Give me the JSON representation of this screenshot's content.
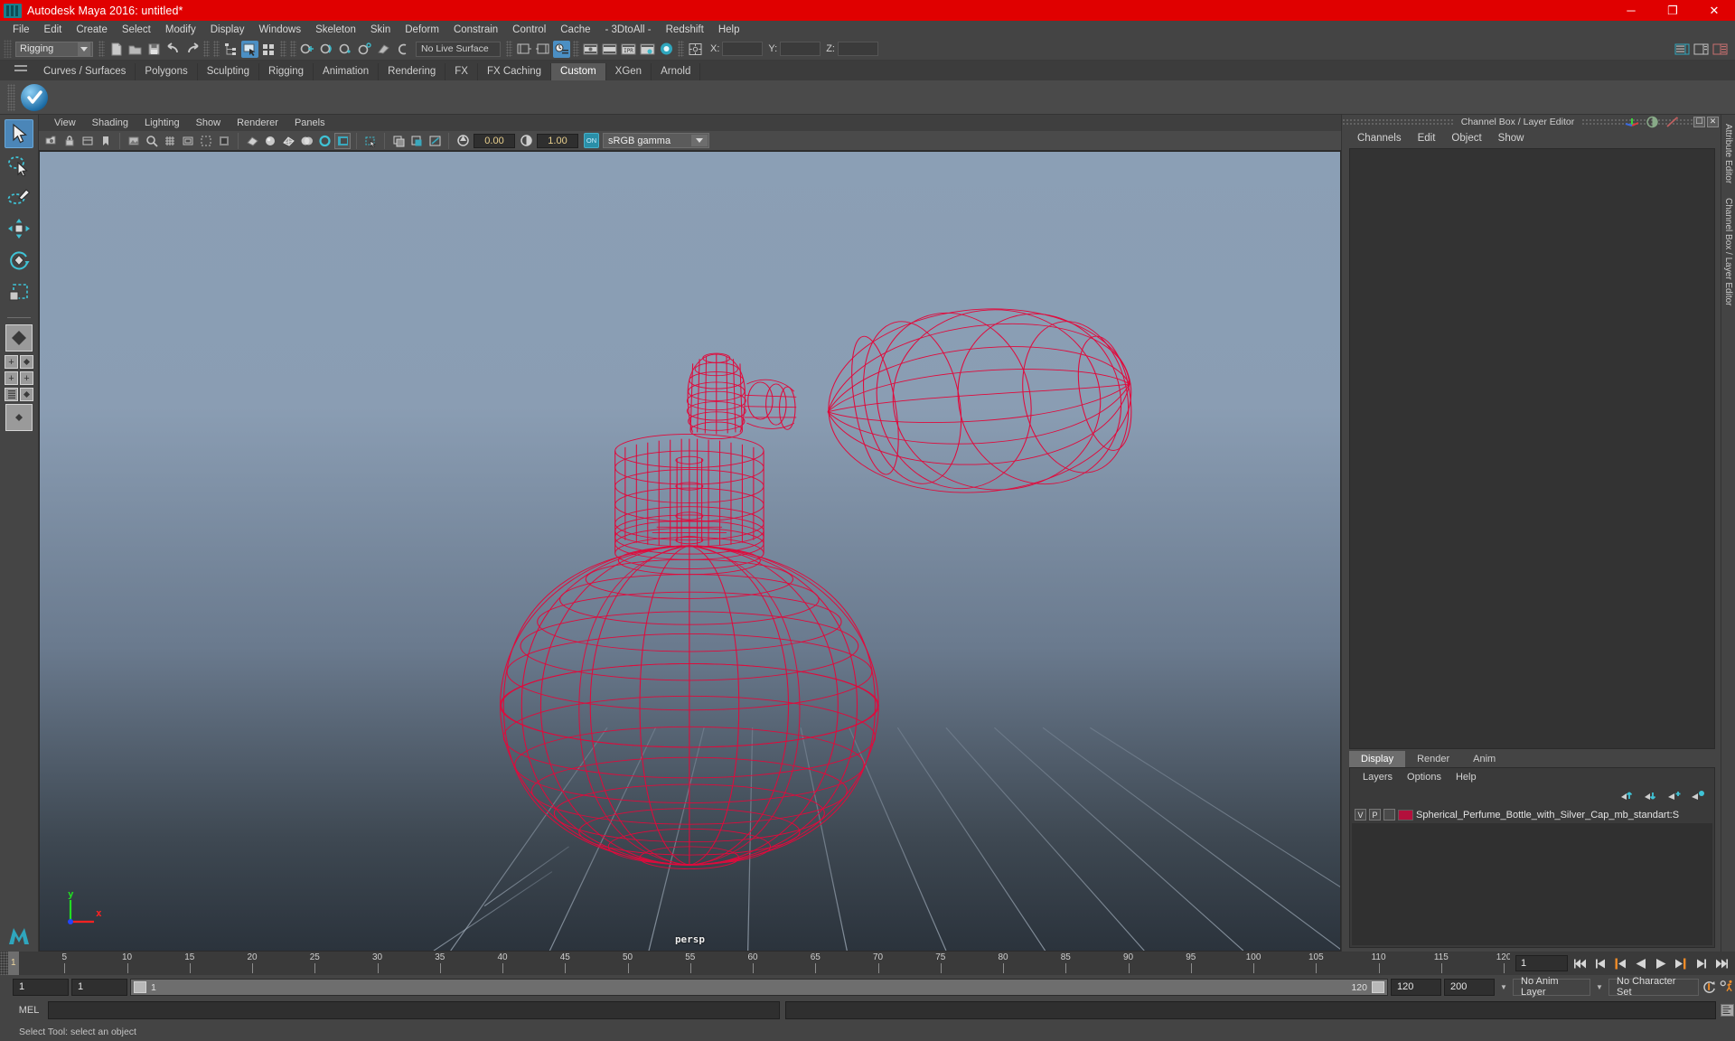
{
  "window": {
    "title": "Autodesk Maya 2016: untitled*",
    "app_icon": "maya-logo-icon",
    "controls": {
      "minimize": "─",
      "maximize": "❐",
      "close": "✕"
    },
    "titlebar_color": "#e00000"
  },
  "menubar": {
    "items": [
      "File",
      "Edit",
      "Create",
      "Select",
      "Modify",
      "Display",
      "Windows",
      "Skeleton",
      "Skin",
      "Deform",
      "Constrain",
      "Control",
      "Cache",
      "- 3DtoAll -",
      "Redshift",
      "Help"
    ]
  },
  "statusbar": {
    "mode": "Rigging",
    "live_surface": "No Live Surface",
    "coords": {
      "x_label": "X:",
      "x_value": "",
      "y_label": "Y:",
      "y_value": "",
      "z_label": "Z:",
      "z_value": ""
    }
  },
  "shelf": {
    "tabs": [
      "Curves / Surfaces",
      "Polygons",
      "Sculpting",
      "Rigging",
      "Animation",
      "Rendering",
      "FX",
      "FX Caching",
      "Custom",
      "XGen",
      "Arnold"
    ],
    "active_tab": "Custom",
    "buttons": [
      {
        "name": "3dtoall-check-icon"
      }
    ]
  },
  "viewport": {
    "menus": [
      "View",
      "Shading",
      "Lighting",
      "Show",
      "Renderer",
      "Panels"
    ],
    "exposure": "0.00",
    "gamma": "1.00",
    "color_profile": "sRGB gamma",
    "color_profile_toggle": "ON",
    "camera_label": "persp",
    "axis": {
      "x": "x",
      "y": "y"
    },
    "wireframe_color": "#e00a3c",
    "background_top": "#8b9fb5",
    "background_bottom": "#2b333c"
  },
  "channel_box": {
    "panel_title": "Channel Box / Layer Editor",
    "menus": [
      "Channels",
      "Edit",
      "Object",
      "Show"
    ]
  },
  "layer_editor": {
    "tabs": [
      "Display",
      "Render",
      "Anim"
    ],
    "active_tab": "Display",
    "menus": [
      "Layers",
      "Options",
      "Help"
    ],
    "layers": [
      {
        "visibility": "V",
        "playback": "P",
        "color": "#b3103c",
        "name": "Spherical_Perfume_Bottle_with_Silver_Cap_mb_standart:S"
      }
    ]
  },
  "right_sidebar": {
    "tabs": [
      "Attribute Editor",
      "Channel Box / Layer Editor"
    ]
  },
  "timeline": {
    "ticks": [
      5,
      10,
      15,
      20,
      25,
      30,
      35,
      40,
      45,
      50,
      55,
      60,
      65,
      70,
      75,
      80,
      85,
      90,
      95,
      100,
      105,
      110,
      115,
      120
    ],
    "start": 1,
    "end": 120,
    "current_frame": "1",
    "current_frame_field": "1",
    "playback_buttons": [
      "go-to-start-icon",
      "step-back-keyframe-icon",
      "step-back-frame-icon",
      "play-backwards-icon",
      "play-forwards-icon",
      "step-forward-frame-icon",
      "step-forward-keyframe-icon",
      "go-to-end-icon"
    ]
  },
  "range_slider": {
    "anim_start": "1",
    "range_start": "1",
    "slider_left_label": "1",
    "slider_right_label": "120",
    "range_end": "120",
    "anim_end": "200",
    "anim_layer": "No Anim Layer",
    "character_set": "No Character Set"
  },
  "command_line": {
    "language": "MEL",
    "input_value": "",
    "output_value": ""
  },
  "status_help": {
    "message": "Select Tool: select an object"
  },
  "toolbox": {
    "tools": [
      {
        "name": "select-tool",
        "active": true
      },
      {
        "name": "lasso-select-tool",
        "active": false
      },
      {
        "name": "paint-select-tool",
        "active": false
      },
      {
        "name": "move-tool",
        "active": false
      },
      {
        "name": "rotate-tool",
        "active": false
      },
      {
        "name": "scale-tool",
        "active": false
      }
    ],
    "layouts": [
      {
        "name": "single-perspective-view"
      },
      {
        "name": "four-view-layout"
      },
      {
        "name": "outliner-persp-layout"
      },
      {
        "name": "persp-graph-layout"
      }
    ]
  }
}
